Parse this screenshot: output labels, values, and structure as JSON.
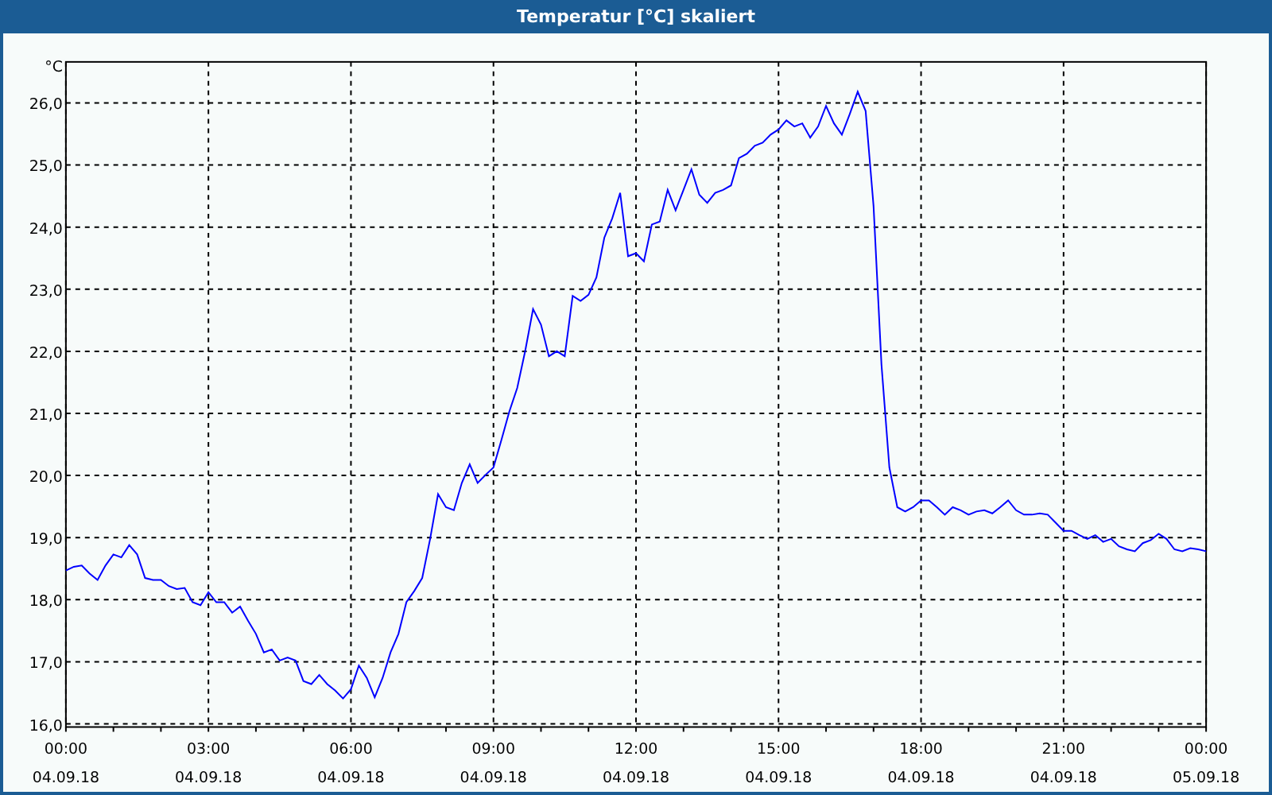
{
  "window": {
    "title": "Temperatur [°C] skaliert"
  },
  "chart_data": {
    "type": "line",
    "grid": true,
    "ylabel": "°C",
    "ylim": [
      15.95,
      26.66
    ],
    "yticks": [
      {
        "value": 16,
        "label": "16,0"
      },
      {
        "value": 17,
        "label": "17,0"
      },
      {
        "value": 18,
        "label": "18,0"
      },
      {
        "value": 19,
        "label": "19,0"
      },
      {
        "value": 20,
        "label": "20,0"
      },
      {
        "value": 21,
        "label": "21,0"
      },
      {
        "value": 22,
        "label": "22,0"
      },
      {
        "value": 23,
        "label": "23,0"
      },
      {
        "value": 24,
        "label": "24,0"
      },
      {
        "value": 25,
        "label": "25,0"
      },
      {
        "value": 26,
        "label": "26,0"
      }
    ],
    "categories": [
      "00:00 04.09.18",
      null,
      null,
      null,
      null,
      null,
      null,
      null,
      null,
      null,
      null,
      null,
      null,
      null,
      null,
      null,
      null,
      null,
      "03:00 04.09.18",
      null,
      null,
      null,
      null,
      null,
      null,
      null,
      null,
      null,
      null,
      null,
      null,
      null,
      null,
      null,
      null,
      null,
      "06:00 04.09.18",
      null,
      null,
      null,
      null,
      null,
      null,
      null,
      null,
      null,
      null,
      null,
      null,
      null,
      null,
      null,
      null,
      null,
      "09:00 04.09.18",
      null,
      null,
      null,
      null,
      null,
      null,
      null,
      null,
      null,
      null,
      null,
      null,
      null,
      null,
      null,
      null,
      null,
      "12:00 04.09.18",
      null,
      null,
      null,
      null,
      null,
      null,
      null,
      null,
      null,
      null,
      null,
      null,
      null,
      null,
      null,
      null,
      null,
      "15:00 04.09.18",
      null,
      null,
      null,
      null,
      null,
      null,
      null,
      null,
      null,
      null,
      null,
      null,
      null,
      null,
      null,
      null,
      null,
      "18:00 04.09.18",
      null,
      null,
      null,
      null,
      null,
      null,
      null,
      null,
      null,
      null,
      null,
      null,
      null,
      null,
      null,
      null,
      null,
      "21:00 04.09.18",
      null,
      null,
      null,
      null,
      null,
      null,
      null,
      null,
      null,
      null,
      null,
      null,
      null,
      null,
      null,
      null,
      null,
      "00:00 05.09.18"
    ],
    "series": [
      {
        "color": "#0000ff",
        "values": [
          18.47,
          18.53,
          18.55,
          18.42,
          18.32,
          18.55,
          18.73,
          18.68,
          18.88,
          18.73,
          18.35,
          18.32,
          18.32,
          18.22,
          18.17,
          18.19,
          17.96,
          17.91,
          18.12,
          17.96,
          17.96,
          17.79,
          17.89,
          17.66,
          17.45,
          17.15,
          17.2,
          17.02,
          17.07,
          17.02,
          16.69,
          16.64,
          16.79,
          16.64,
          16.54,
          16.41,
          16.56,
          16.94,
          16.74,
          16.43,
          16.74,
          17.15,
          17.45,
          17.96,
          18.14,
          18.35,
          18.98,
          19.7,
          19.49,
          19.44,
          19.88,
          20.18,
          19.88,
          20.01,
          20.13,
          20.57,
          21.03,
          21.41,
          22.0,
          22.68,
          22.43,
          21.92,
          22.0,
          21.92,
          22.89,
          22.81,
          22.91,
          23.19,
          23.83,
          24.14,
          24.55,
          23.53,
          23.58,
          23.45,
          24.04,
          24.09,
          24.6,
          24.27,
          24.6,
          24.93,
          24.52,
          24.39,
          24.55,
          24.6,
          24.67,
          25.11,
          25.18,
          25.31,
          25.36,
          25.49,
          25.57,
          25.72,
          25.62,
          25.67,
          25.44,
          25.62,
          25.95,
          25.67,
          25.49,
          25.82,
          26.18,
          25.87,
          24.34,
          21.79,
          20.13,
          19.49,
          19.42,
          19.49,
          19.6,
          19.6,
          19.49,
          19.37,
          19.49,
          19.44,
          19.37,
          19.42,
          19.44,
          19.39,
          19.49,
          19.6,
          19.44,
          19.37,
          19.37,
          19.39,
          19.37,
          19.24,
          19.11,
          19.11,
          19.04,
          18.98,
          19.04,
          18.93,
          18.98,
          18.86,
          18.81,
          18.78,
          18.91,
          18.96,
          19.06,
          18.98,
          18.81,
          18.78,
          18.83,
          18.81,
          18.78
        ]
      }
    ]
  }
}
